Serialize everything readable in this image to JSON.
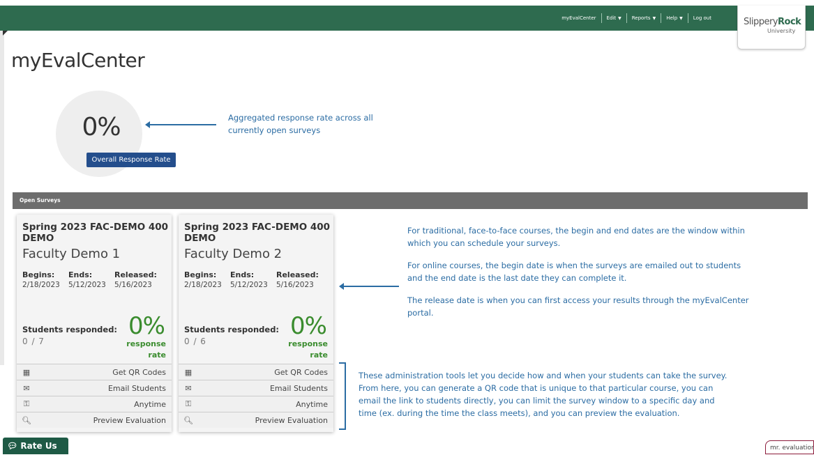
{
  "nav": {
    "items": [
      {
        "label": "myEvalCenter",
        "dropdown": false
      },
      {
        "label": "Edit",
        "dropdown": true
      },
      {
        "label": "Reports",
        "dropdown": true
      },
      {
        "label": "Help",
        "dropdown": true
      },
      {
        "label": "Log out",
        "dropdown": false
      }
    ],
    "brand_color": "#2e6b4f"
  },
  "logo": {
    "part1": "Slippery",
    "part2": "Rock",
    "sub": "University"
  },
  "page_title": "myEvalCenter",
  "overall": {
    "value": "0%",
    "button_label": "Overall Response Rate"
  },
  "annotations": {
    "aggregated": "Aggregated response rate across all currently open surveys",
    "dates": [
      "For traditional, face-to-face courses, the begin and end dates are the window within which you can schedule your surveys.",
      "For online courses, the begin date is when the surveys are emailed out to students and the end date is the last date they can complete it.",
      "The release date is when you can first access your results through the myEvalCenter portal."
    ],
    "tools": "These administration tools let you decide how and when your students can take the survey. From here, you can generate a QR code that is unique to that particular course, you can email the link to students directly, you can limit the survey window to a specific day and time (ex. during the time the class meets), and you can preview the evaluation."
  },
  "open_surveys_label": "Open Surveys",
  "date_labels": {
    "begins": "Begins:",
    "ends": "Ends:",
    "released": "Released:"
  },
  "responded_label": "Students responded:",
  "rate_word": "response rate",
  "surveys": [
    {
      "title": "Spring 2023 FAC-DEMO 400 DEMO",
      "subtitle": "Faculty Demo 1",
      "begins": "2/18/2023",
      "ends": "5/12/2023",
      "released": "5/16/2023",
      "count": "0 / 7",
      "pct": "0%"
    },
    {
      "title": "Spring 2023 FAC-DEMO 400 DEMO",
      "subtitle": "Faculty Demo 2",
      "begins": "2/18/2023",
      "ends": "5/12/2023",
      "released": "5/16/2023",
      "count": "0 / 6",
      "pct": "0%"
    }
  ],
  "tools": [
    {
      "label": "Get QR Codes",
      "icon": "qr-code-icon"
    },
    {
      "label": "Email Students",
      "icon": "email-icon"
    },
    {
      "label": "Anytime",
      "icon": "key-icon"
    },
    {
      "label": "Preview Evaluation",
      "icon": "magnifier-icon"
    }
  ],
  "rate_us_label": "Rate Us",
  "mr_eval_label": "mr. evaluation"
}
